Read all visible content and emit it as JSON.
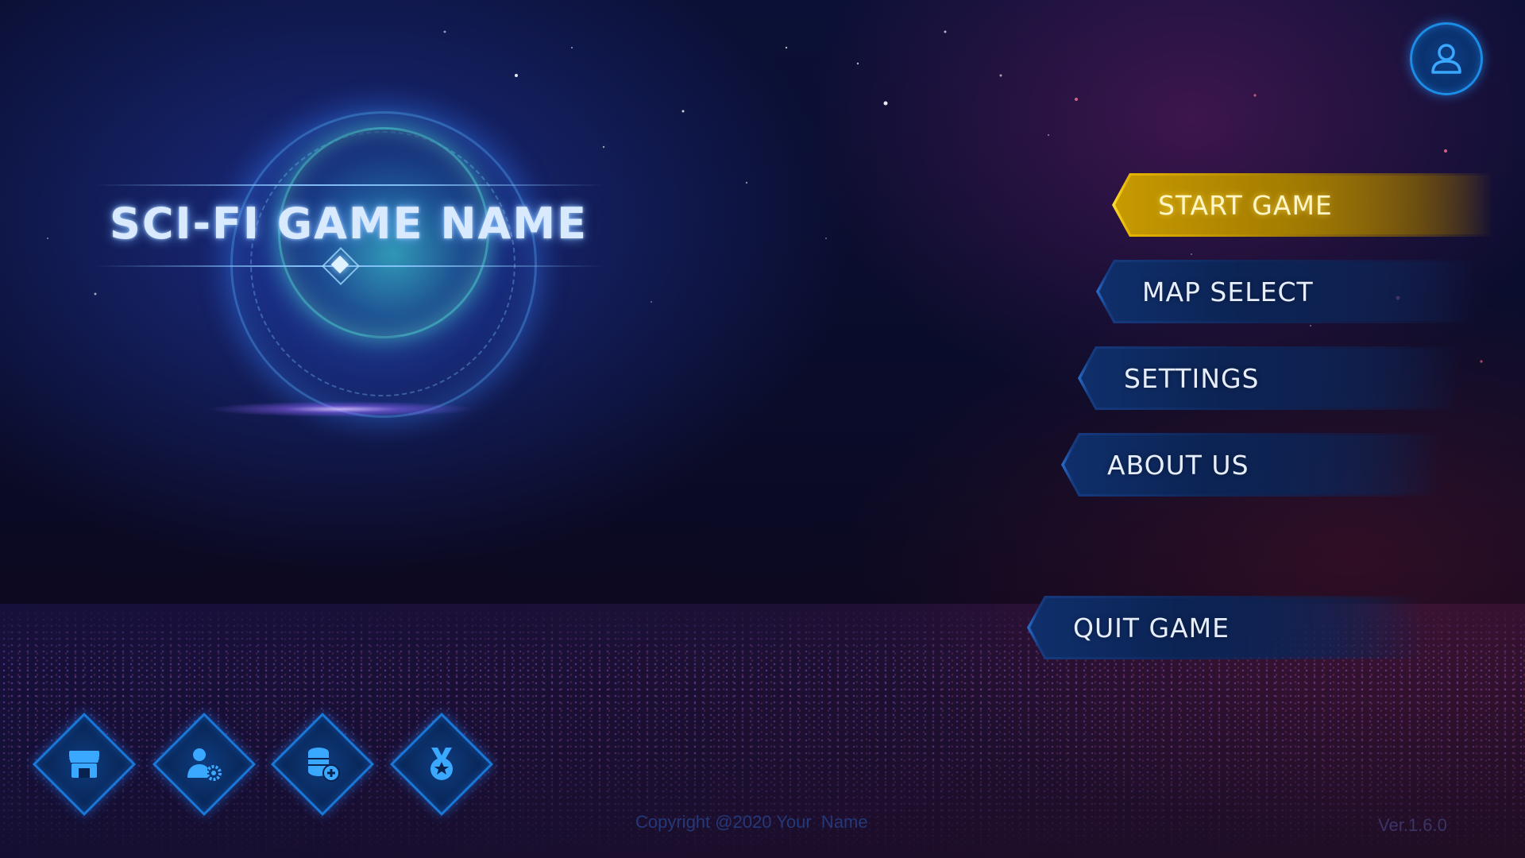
{
  "game": {
    "title": "SCI-FI GAME NAME"
  },
  "menu": {
    "start": "START GAME",
    "map": "MAP SELECT",
    "settings": "SETTINGS",
    "about": "ABOUT US",
    "quit": "QUIT GAME"
  },
  "footer": {
    "copyright": "Copyright @2020 Your  Name",
    "version": "Ver.1.6.0"
  },
  "icons": {
    "profile": "user-icon",
    "shop": "shop-icon",
    "account_settings": "user-settings-icon",
    "coins": "coins-add-icon",
    "achievements": "medal-icon"
  },
  "colors": {
    "accent_blue": "#1c8de6",
    "highlight_gold": "#e6b400"
  }
}
